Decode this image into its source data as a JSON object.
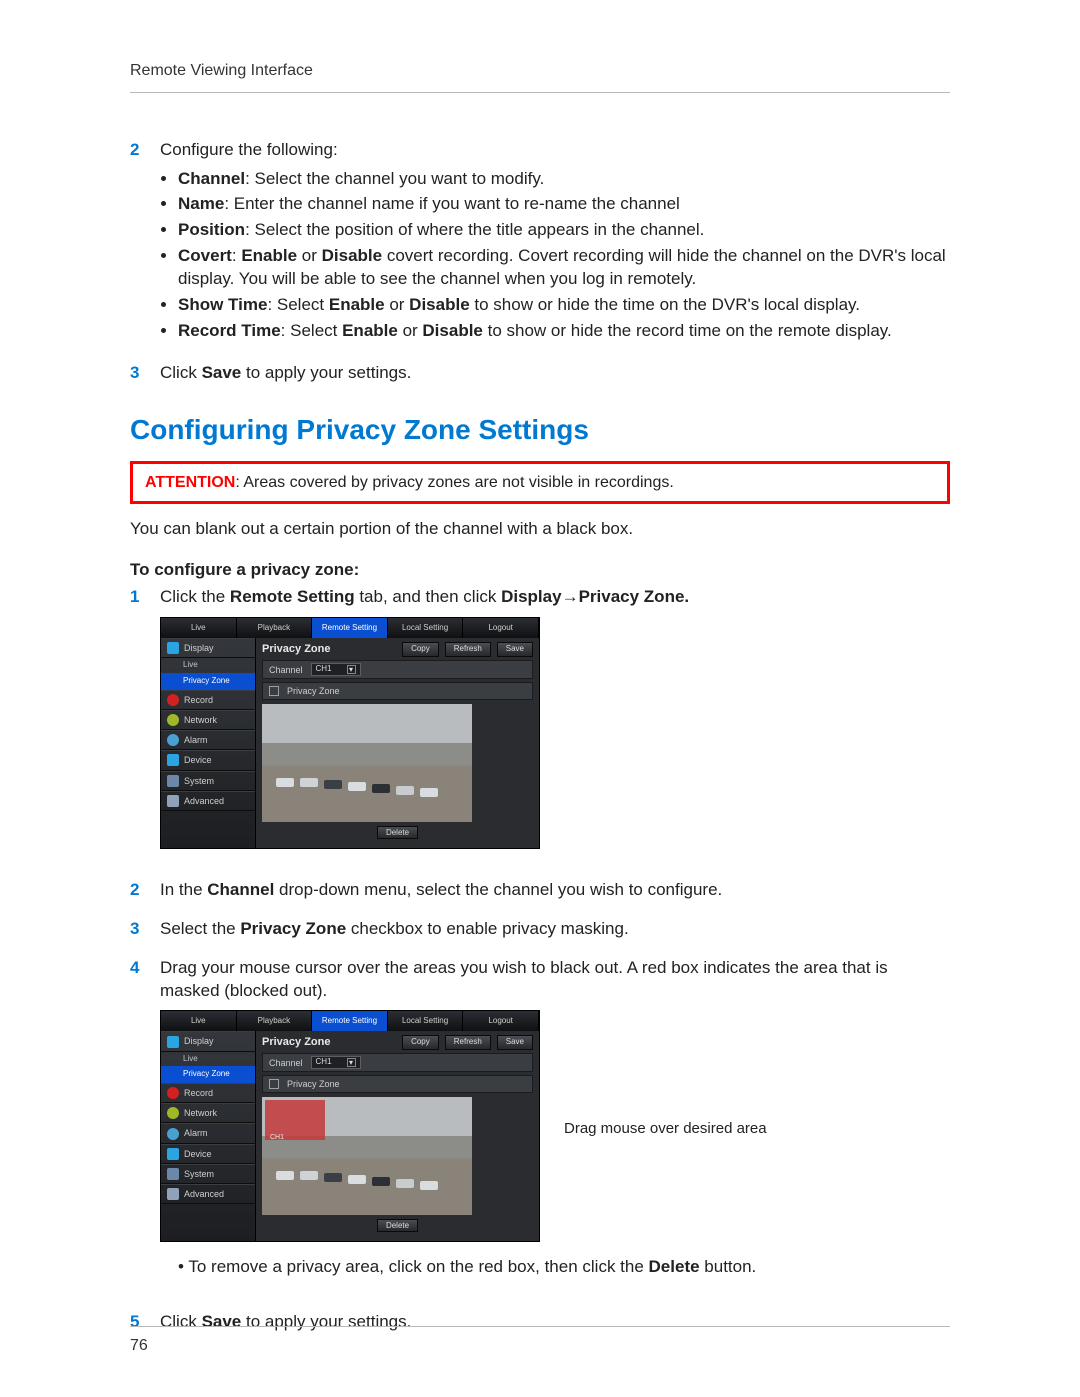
{
  "header": {
    "title": "Remote Viewing Interface"
  },
  "footer": {
    "page_number": "76"
  },
  "step2": {
    "num": "2",
    "lead": "Configure the following:",
    "bullets": [
      {
        "label": "Channel",
        "text": ": Select the channel you want to modify."
      },
      {
        "label": "Name",
        "text": ": Enter the channel name if you want to re-name the channel"
      },
      {
        "label": "Position",
        "text": ": Select the position of where the title appears in the channel."
      },
      {
        "label": "Covert",
        "text_before": ": ",
        "opt1": "Enable",
        "mid": " or ",
        "opt2": "Disable",
        "text_after": " covert recording. Covert recording will hide the channel on the DVR's local display. You will be able to see the channel when you log in remotely."
      },
      {
        "label": "Show Time",
        "text_before": ": Select ",
        "opt1": "Enable",
        "mid": " or ",
        "opt2": "Disable",
        "text_after": " to show or hide the time on the DVR's local display."
      },
      {
        "label": "Record Time",
        "text_before": ": Select ",
        "opt1": "Enable",
        "mid": " or ",
        "opt2": "Disable",
        "text_after": " to show or hide the record time on the remote display."
      }
    ]
  },
  "step3_prev": {
    "num": "3",
    "pre": "Click ",
    "bold": "Save",
    "post": " to apply your settings."
  },
  "section": {
    "title": "Configuring Privacy Zone Settings"
  },
  "attention": {
    "label": "ATTENTION",
    "text": ": Areas covered by privacy zones are not visible in recordings."
  },
  "intro": {
    "text": "You can blank out a certain portion of the channel with a black box."
  },
  "subhead": {
    "text": "To configure a privacy zone:"
  },
  "steps": {
    "s1": {
      "num": "1",
      "pre": "Click the ",
      "b1": "Remote Setting",
      "mid1": " tab, and then click ",
      "b2": "Display",
      "arrow": "→",
      "b3": "Privacy Zone."
    },
    "s2": {
      "num": "2",
      "pre": "In the ",
      "b1": "Channel",
      "post": " drop-down menu, select the channel you wish to configure."
    },
    "s3": {
      "num": "3",
      "pre": "Select the ",
      "b1": "Privacy Zone",
      "post": " checkbox to enable privacy masking."
    },
    "s4": {
      "num": "4",
      "text": "Drag your mouse cursor over the areas you wish to black out. A red box indicates the area that is masked (blocked out)."
    },
    "s4_note": {
      "pre": "• To remove a privacy area, click on the red box, then click the ",
      "b1": "Delete",
      "post": " button."
    },
    "s5": {
      "num": "5",
      "pre": "Click ",
      "b1": "Save",
      "post": " to apply your settings."
    }
  },
  "dvr": {
    "tabs": [
      "Live",
      "Playback",
      "Remote Setting",
      "Local Setting",
      "Logout"
    ],
    "active_tab_index": 2,
    "sidebar": {
      "items": [
        {
          "label": "Display",
          "icon": "display"
        },
        {
          "label": "Record",
          "icon": "record"
        },
        {
          "label": "Network",
          "icon": "network"
        },
        {
          "label": "Alarm",
          "icon": "alarm"
        },
        {
          "label": "Device",
          "icon": "device"
        },
        {
          "label": "System",
          "icon": "system"
        },
        {
          "label": "Advanced",
          "icon": "advanced"
        }
      ],
      "display_children": [
        {
          "label": "Live",
          "active": false
        },
        {
          "label": "Privacy Zone",
          "active": true
        }
      ]
    },
    "panel": {
      "title": "Privacy Zone",
      "buttons": {
        "copy": "Copy",
        "refresh": "Refresh",
        "save": "Save"
      },
      "channel_label": "Channel",
      "channel_value": "CH1",
      "privacy_label": "Privacy Zone",
      "delete": "Delete",
      "mask_label": "CH1"
    }
  },
  "callout": {
    "text": "Drag mouse over desired area"
  }
}
